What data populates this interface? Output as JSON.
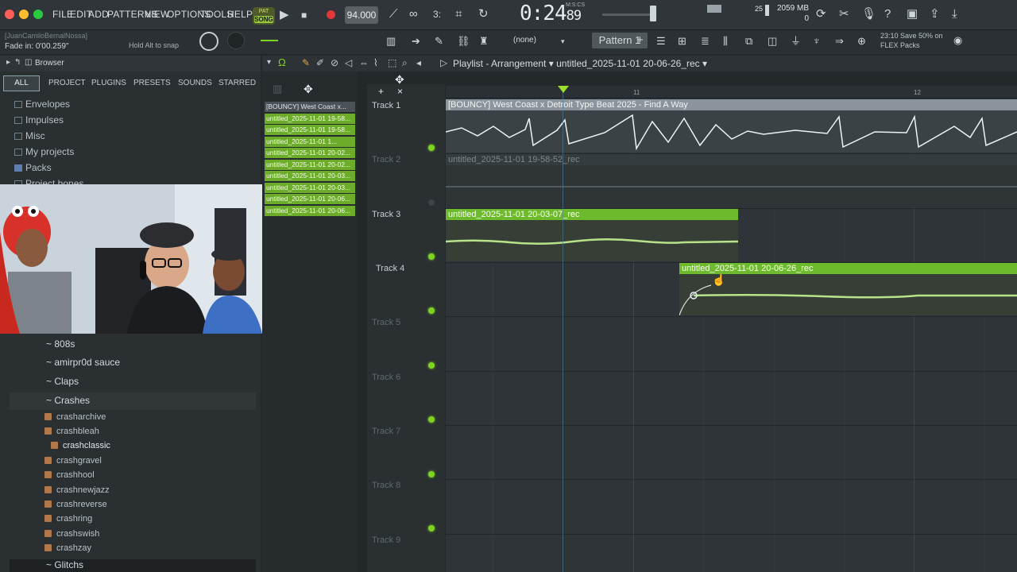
{
  "menu": [
    "FILE",
    "EDIT",
    "ADD",
    "PATTERNS",
    "VIEW",
    "OPTIONS",
    "TOOLS",
    "HELP"
  ],
  "transport": {
    "pat_label": "PAT",
    "song_label": "SONG",
    "tempo": "94.000",
    "time_main": "0:24",
    "time_frac": "89",
    "time_unit": "M:S:CS"
  },
  "cpu": {
    "value": "25",
    "memory": "2059 MB",
    "voices": "0"
  },
  "hint": {
    "user": "[JuanCamiloBernalNossa]",
    "fade": "Fade in:  0'00.259\"",
    "snap": "Hold Alt to snap"
  },
  "pattern": {
    "selector": "(none)",
    "name": "Pattern 1"
  },
  "promo": {
    "line1": "23:10  Save 50% on",
    "line2": "FLEX Packs"
  },
  "browser": {
    "title": "Browser",
    "tabs": [
      "ALL",
      "PROJECT",
      "PLUGINS",
      "PRESETS",
      "SOUNDS",
      "STARRED"
    ],
    "items": [
      "Envelopes",
      "Impulses",
      "Misc",
      "My projects",
      "Packs",
      "Project bones"
    ],
    "folders": [
      "~ 808s",
      "~ amirpr0d sauce",
      "~ Claps",
      "~ Crashes",
      "~ Glitchs"
    ],
    "files": [
      "crasharchive",
      "crashbleah",
      "crashclassic",
      "crashgravel",
      "crashhool",
      "crashnewjazz",
      "crashreverse",
      "crashring",
      "crashswish",
      "crashzay"
    ]
  },
  "playlist": {
    "title": "Playlist - Arrangement",
    "project": "untitled_2025-11-01 20-06-26_rec",
    "picker": [
      "[BOUNCY] West Coast x...",
      "untitled_2025-11-01 19-58...",
      "untitled_2025-11-01 19-58...",
      "untitled_2025-11-01 1...",
      "untitled_2025-11-01 20-02...",
      "untitled_2025-11-01 20-02...",
      "untitled_2025-11-01 20-03...",
      "untitled_2025-11-01 20-03...",
      "untitled_2025-11-01 20-06...",
      "untitled_2025-11-01 20-06..."
    ],
    "tracks": [
      "Track 1",
      "Track 2",
      "Track 3",
      "Track 4",
      "Track 5",
      "Track 6",
      "Track 7",
      "Track 8",
      "Track 9"
    ],
    "bars": [
      "11",
      "12"
    ],
    "clips": {
      "c1": "[BOUNCY] West Coast x Detroit Type Beat 2025 - Find A Way",
      "c2": "untitled_2025-11-01 19-58-52_rec",
      "c3": "untitled_2025-11-01 20-03-07_rec",
      "c4": "untitled_2025-11-01 20-06-26_rec"
    }
  }
}
